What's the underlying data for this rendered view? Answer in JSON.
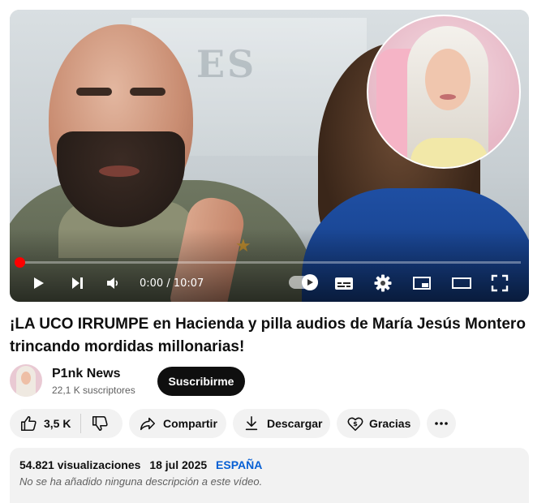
{
  "player": {
    "time_display": "0:00 / 10:07",
    "progress_fraction": 0.0,
    "accent_color": "#ff0000",
    "controls": {
      "play": "play-icon",
      "next": "next-icon",
      "volume": "volume-icon",
      "autoplay": "autoplay-toggle",
      "subtitles": "subtitles-icon",
      "settings": "gear-icon",
      "miniplayer": "miniplayer-icon",
      "theater": "theater-icon",
      "fullscreen": "fullscreen-icon"
    }
  },
  "video": {
    "title": "¡LA UCO IRRUMPE en Hacienda y pilla audios de María Jesús Montero trincando mordidas millonarias!"
  },
  "channel": {
    "name": "P1nk News",
    "subscribers": "22,1 K suscriptores",
    "subscribe_label": "Suscribirme"
  },
  "actions": {
    "like_count": "3,5 K",
    "share_label": "Compartir",
    "download_label": "Descargar",
    "thanks_label": "Gracias"
  },
  "description": {
    "views": "54.821 visualizaciones",
    "date": "18 jul 2025",
    "tag": "ESPAÑA",
    "text": "No se ha añadido ninguna descripción a este vídeo."
  }
}
